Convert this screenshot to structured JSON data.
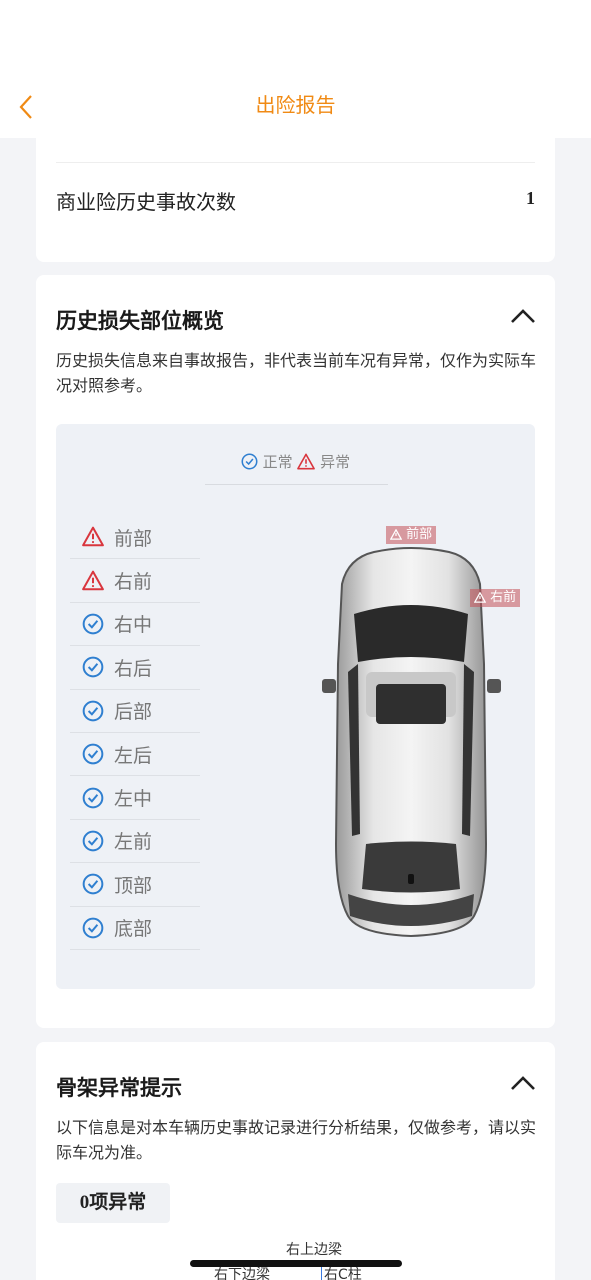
{
  "header": {
    "title": "出险报告",
    "back_icon": "chevron-left-icon"
  },
  "summary": {
    "label": "商业险历史事故次数",
    "value": "1"
  },
  "damage": {
    "title": "历史损失部位概览",
    "description": "历史损失信息来自事故报告，非代表当前车况有异常，仅作为实际车况对照参考。",
    "legend": {
      "normal": "正常",
      "abnormal": "异常"
    },
    "parts": [
      {
        "label": "前部",
        "status": "abnormal"
      },
      {
        "label": "右前",
        "status": "abnormal"
      },
      {
        "label": "右中",
        "status": "normal"
      },
      {
        "label": "右后",
        "status": "normal"
      },
      {
        "label": "后部",
        "status": "normal"
      },
      {
        "label": "左后",
        "status": "normal"
      },
      {
        "label": "左中",
        "status": "normal"
      },
      {
        "label": "左前",
        "status": "normal"
      },
      {
        "label": "顶部",
        "status": "normal"
      },
      {
        "label": "底部",
        "status": "normal"
      }
    ],
    "car_tags": [
      "前部",
      "右前"
    ]
  },
  "skeleton": {
    "title": "骨架异常提示",
    "description": "以下信息是对本车辆历史事故记录进行分析结果，仅做参考，请以实际车况为准。",
    "badge": "0项异常",
    "labels": [
      "右上边梁",
      "右下边梁",
      "右C柱"
    ]
  },
  "colors": {
    "accent": "#f08a14",
    "normal": "#2f7fd0",
    "abnormal": "#d9363e"
  }
}
